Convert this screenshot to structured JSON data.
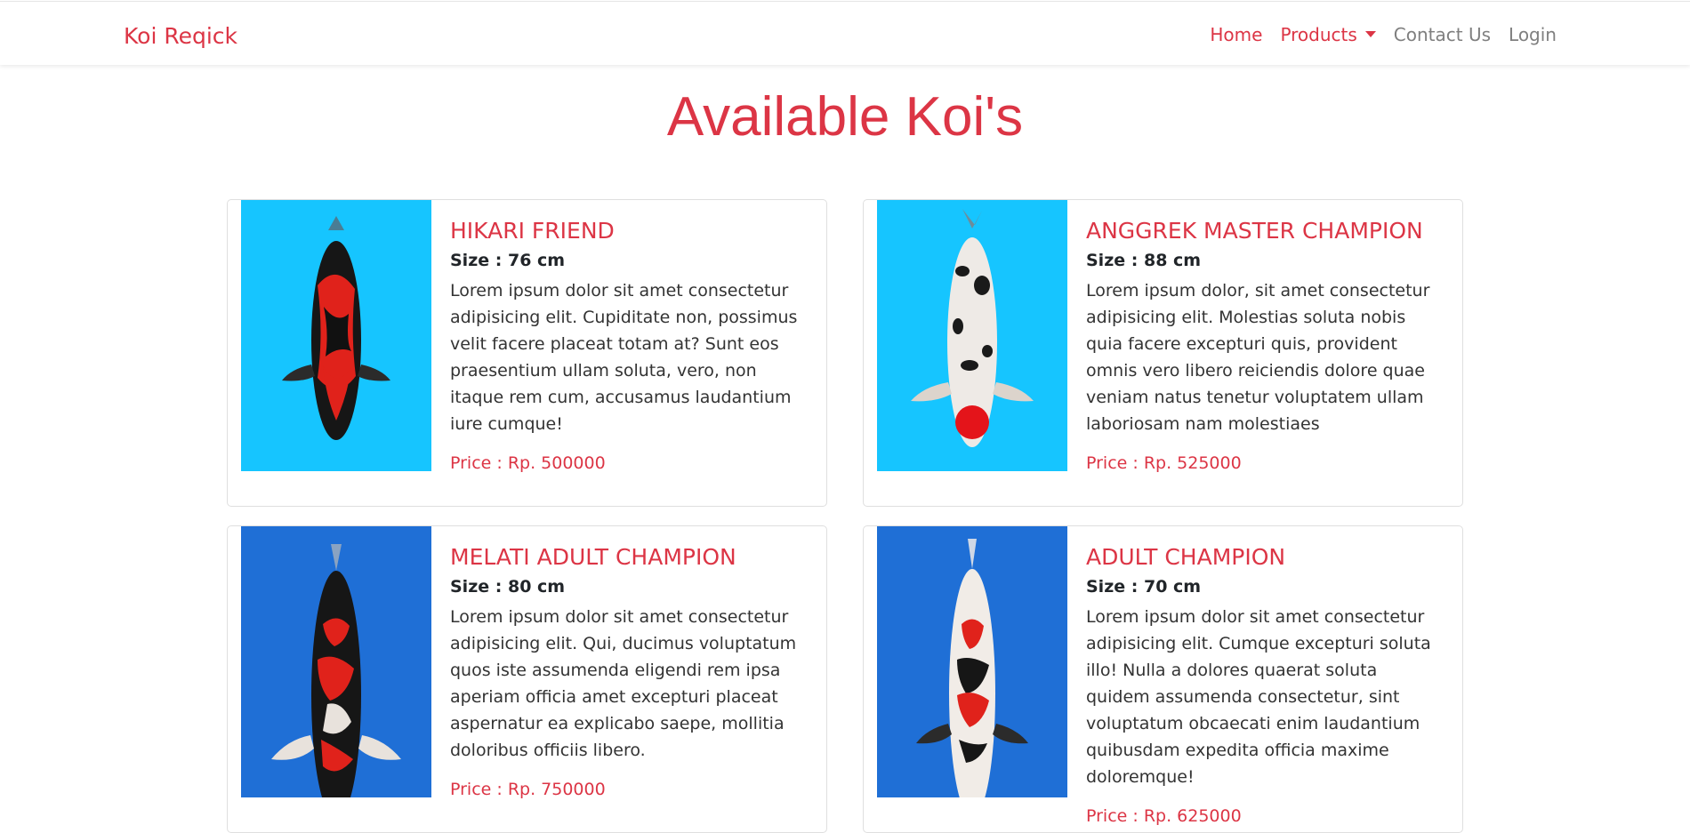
{
  "navbar": {
    "brand": "Koi Reqick",
    "links": [
      {
        "label": "Home"
      },
      {
        "label": "Products"
      },
      {
        "label": "Contact Us"
      },
      {
        "label": "Login"
      }
    ]
  },
  "page": {
    "title": "Available Koi's"
  },
  "products": [
    {
      "name": "HIKARI FRIEND",
      "size": "Size : 76 cm",
      "description": "Lorem ipsum dolor sit amet consectetur adipisicing elit. Cupiditate non, possimus velit facere placeat totam at? Sunt eos praesentium ullam soluta, vero, non itaque rem cum, accusamus laudantium iure cumque!",
      "price": "Price : Rp. 500000"
    },
    {
      "name": "ANGGREK MASTER CHAMPION",
      "size": "Size : 88 cm",
      "description": "Lorem ipsum dolor, sit amet consectetur adipisicing elit. Molestias soluta nobis quia facere excepturi quis, provident omnis vero libero reiciendis dolore quae veniam natus tenetur voluptatem ullam laboriosam nam molestiaes",
      "price": "Price : Rp. 525000"
    },
    {
      "name": "MELATI ADULT CHAMPION",
      "size": "Size : 80 cm",
      "description": "Lorem ipsum dolor sit amet consectetur adipisicing elit. Qui, ducimus voluptatum quos iste assumenda eligendi rem ipsa aperiam officia amet excepturi placeat aspernatur ea explicabo saepe, mollitia doloribus officiis libero.",
      "price": "Price : Rp. 750000"
    },
    {
      "name": "ADULT CHAMPION",
      "size": "Size : 70 cm",
      "description": "Lorem ipsum dolor sit amet consectetur adipisicing elit. Cumque excepturi soluta illo! Nulla a dolores quaerat soluta quidem assumenda consectetur, sint voluptatum obcaecati enim laudantium quibusdam expedita officia maxime doloremque!",
      "price": "Price : Rp. 625000"
    }
  ],
  "colors": {
    "accent": "#dc3545",
    "muted_link": "#7f7f7f",
    "photo_bg_light": "#16c5ff",
    "photo_bg_blue": "#1f6fd6"
  }
}
